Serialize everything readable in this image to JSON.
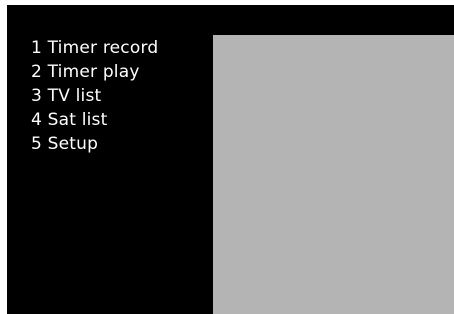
{
  "menu": {
    "items": [
      {
        "label": "1 Timer record"
      },
      {
        "label": "2 Timer play"
      },
      {
        "label": "3 TV list"
      },
      {
        "label": "4 Sat list"
      },
      {
        "label": "5 Setup"
      }
    ]
  },
  "colors": {
    "screen_background": "#000000",
    "menu_text": "#ffffff",
    "preview_pane": "#b4b4b4"
  }
}
